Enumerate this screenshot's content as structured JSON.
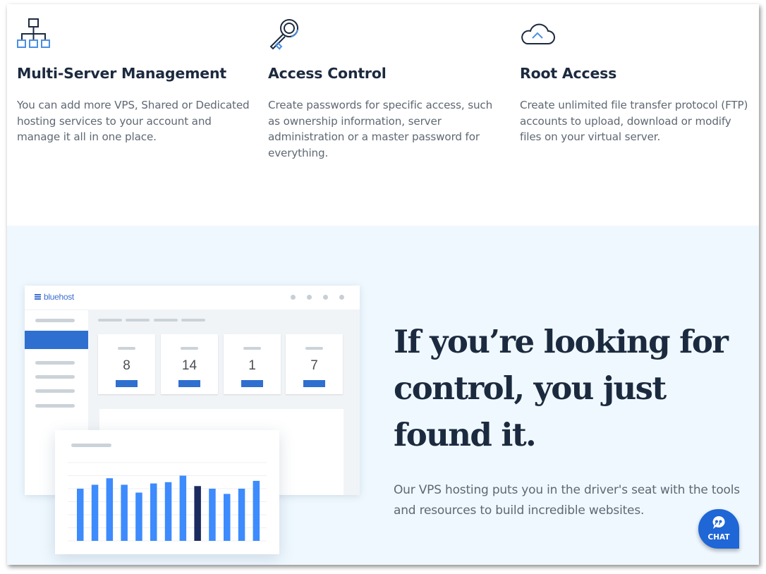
{
  "features": [
    {
      "icon": "sitemap-icon",
      "title": "Multi-Server Management",
      "description": "You can add more VPS, Shared or Dedicated hosting services to your account and manage it all in one place."
    },
    {
      "icon": "key-icon",
      "title": "Access Control",
      "description": "Create passwords for specific access, such as ownership information, server administration or a master password for everything."
    },
    {
      "icon": "cloud-upload-icon",
      "title": "Root Access",
      "description": "Create unlimited file transfer protocol (FTP) accounts to upload, download or modify files on your virtual server."
    }
  ],
  "hero": {
    "headline": "If you’re looking for control, you just found it.",
    "subtext": "Our VPS hosting puts you in the driver's seat with the tools and resources to build incredible websites."
  },
  "dashboard": {
    "logo_text": "bluehost",
    "stats": [
      "8",
      "14",
      "1",
      "7"
    ],
    "chart": {
      "type": "bar",
      "scale_max": 6,
      "values": [
        4.0,
        4.3,
        4.8,
        4.3,
        3.7,
        4.4,
        4.5,
        5.0,
        4.2,
        4.0,
        3.6,
        4.0,
        4.6
      ],
      "highlight_index": 8,
      "bar_color": "#3d8bfd",
      "highlight_color": "#1c2b5e"
    }
  },
  "chat": {
    "label": "CHAT",
    "icon": "chat-bubble-icon"
  },
  "colors": {
    "heading": "#1c2a3f",
    "body_text": "#5f6873",
    "accent_blue": "#2f6fd0",
    "icon_blue": "#4a90e2",
    "hero_bg": "#eff8fe",
    "chat_bg": "#1f66d6"
  }
}
